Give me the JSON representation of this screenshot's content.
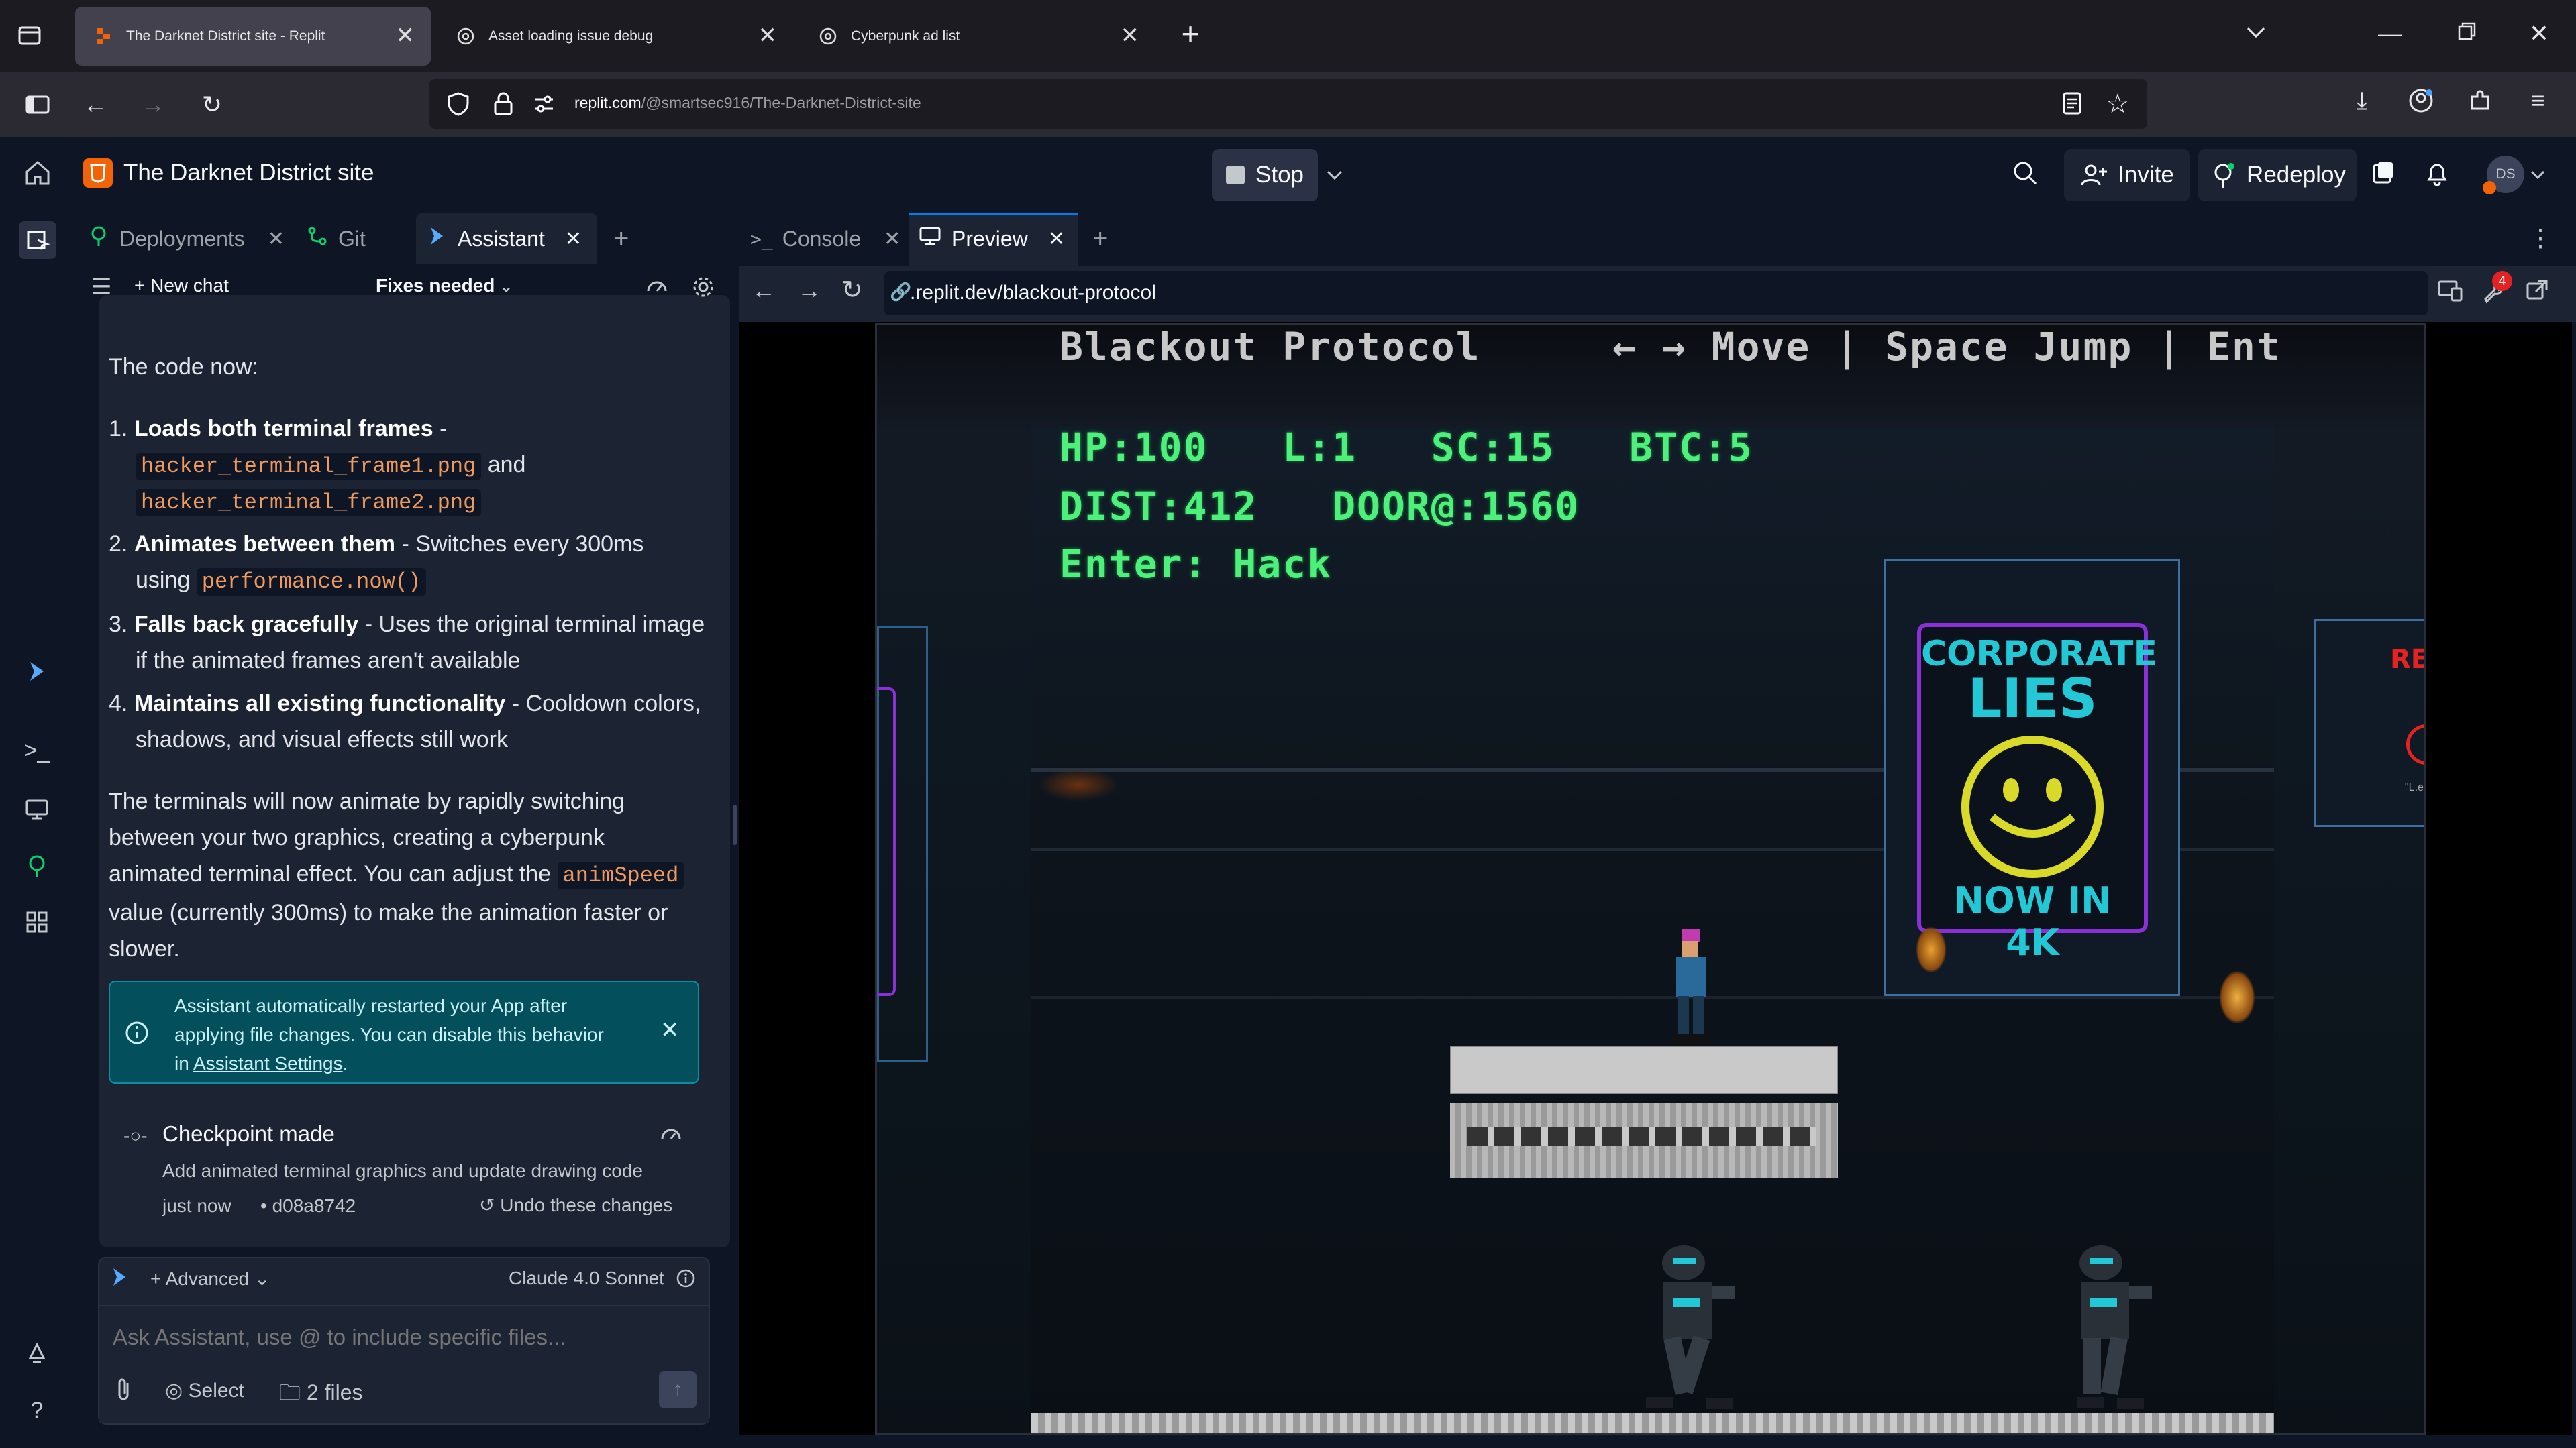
{
  "browser": {
    "tabs": [
      {
        "title": "The Darknet District site - Replit",
        "active": true
      },
      {
        "title": "Asset loading issue debug",
        "active": false
      },
      {
        "title": "Cyberpunk ad list",
        "active": false
      }
    ],
    "url_host": "replit.com",
    "url_path": "/@smartsec916/The-Darknet-District-site"
  },
  "header": {
    "project_title": "The Darknet District site",
    "stop_label": "Stop",
    "invite_label": "Invite",
    "redeploy_label": "Redeploy",
    "avatar_initials": "DS"
  },
  "left_tabs": [
    {
      "label": "Deployments"
    },
    {
      "label": "Git"
    },
    {
      "label": "Assistant"
    }
  ],
  "assistant": {
    "new_chat_label": "New chat",
    "status_label": "Fixes needed",
    "intro": "The code now:",
    "list": [
      {
        "num": "1.",
        "bold": "Loads both terminal frames",
        "rest": " - ",
        "code1": "hacker_terminal_frame1.png",
        "mid": " and",
        "code2": "hacker_terminal_frame2.png"
      },
      {
        "num": "2.",
        "bold": "Animates between them",
        "rest": " - Switches every 300ms",
        "line2": "using",
        "code1": "performance.now()"
      },
      {
        "num": "3.",
        "bold": "Falls back gracefully",
        "rest": " - Uses the original terminal image",
        "line2": "if the animated frames aren't available"
      },
      {
        "num": "4.",
        "bold": "Maintains all existing functionality",
        "rest": " - Cooldown colors,",
        "line2": "shadows, and visual effects still work"
      }
    ],
    "para_lines": [
      "The terminals will now animate by rapidly switching",
      "between your two graphics, creating a cyberpunk",
      "animated terminal effect. You can adjust the"
    ],
    "para_code": "animSpeed",
    "para_tail1": "value (currently 300ms) to make the animation faster or",
    "para_tail2": "slower.",
    "notice_line1": "Assistant automatically restarted your App after",
    "notice_line2": "applying file changes. You can disable this behavior",
    "notice_in": "in",
    "notice_link": "Assistant Settings",
    "notice_period": ".",
    "checkpoint_title": "Checkpoint made",
    "checkpoint_desc": "Add animated terminal graphics and update drawing code",
    "checkpoint_time": "just now",
    "checkpoint_hash": "• d08a8742",
    "undo_label": "Undo these changes",
    "mode_label": "Advanced",
    "model_label": "Claude 4.0 Sonnet",
    "input_placeholder": "Ask Assistant, use @ to include specific files...",
    "select_label": "Select",
    "files_label": "2 files"
  },
  "right_tabs": [
    {
      "label": "Console"
    },
    {
      "label": "Preview"
    }
  ],
  "preview": {
    "url": ".replit.dev/blackout-protocol",
    "notification_count": "4"
  },
  "game": {
    "title": "Blackout Protocol",
    "controls": "← → Move | Space Jump | Ente",
    "hud_line1": "HP:100   L:1   SC:15   BTC:5",
    "hud_line2": "DIST:412   DOOR@:1560",
    "hud_line3": "Enter: Hack",
    "billboard_line1": "CORPORATE",
    "billboard_line2": "LIES",
    "billboard_line3": "NOW IN 4K",
    "edge_sign": "RE",
    "edge_sign_small": "\"L.e"
  },
  "colors": {
    "accent_orange": "#f26207",
    "hud_green": "#4cf07a",
    "notice_bg": "#03505c",
    "billboard_cyan": "#23c8d6",
    "billboard_purple": "#9b3ee8",
    "billboard_yellow": "#d9d92a"
  }
}
